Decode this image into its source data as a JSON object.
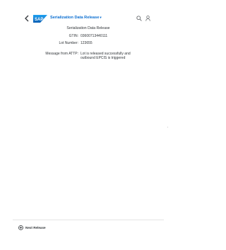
{
  "shell": {
    "app_title": "Serialization Data Release",
    "title_caret": "▾",
    "logo_text": "SAP"
  },
  "form": {
    "section_title": "Serialization Data Release",
    "gtin_label": "GTIN:",
    "gtin_value": "03600713440111",
    "lot_label": "Lot Number:",
    "lot_value": "123655",
    "message_label": "Message from ATTP:",
    "message_value": "Lot is released successfully and outbound EPCIS is triggered"
  },
  "footer": {
    "next_release_label": "Next Release"
  },
  "colors": {
    "brand": "#0a6ed1",
    "text": "#32363a"
  }
}
